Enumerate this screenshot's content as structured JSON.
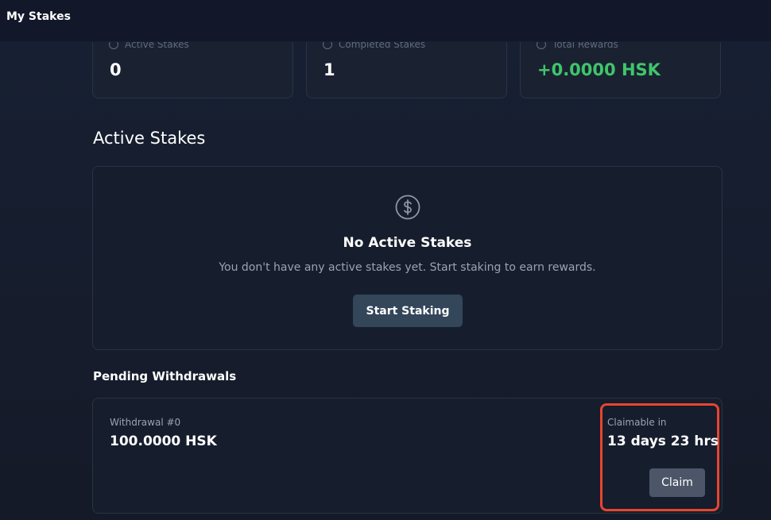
{
  "header": {
    "title": "My Stakes"
  },
  "stats": [
    {
      "label": "Active Stakes",
      "value": "0"
    },
    {
      "label": "Completed Stakes",
      "value": "1"
    },
    {
      "label": "Total Rewards",
      "value": "+0.0000 HSK"
    }
  ],
  "colors": {
    "background": "#161b2a",
    "card": "#1a2232",
    "positive": "#3fc66a",
    "highlight": "#e8452f",
    "button": "#33465a"
  },
  "active_stakes": {
    "title": "Active Stakes",
    "empty_icon": "dollar-circle-icon",
    "empty_title": "No Active Stakes",
    "empty_description": "You don't have any active stakes yet. Start staking to earn rewards.",
    "start_button_label": "Start Staking"
  },
  "pending_withdrawals": {
    "title": "Pending Withdrawals",
    "items": [
      {
        "label": "Withdrawal #0",
        "amount": "100.0000 HSK",
        "claimable_label": "Claimable in",
        "claimable_time": "13 days 23 hrs",
        "claim_label": "Claim"
      }
    ]
  }
}
